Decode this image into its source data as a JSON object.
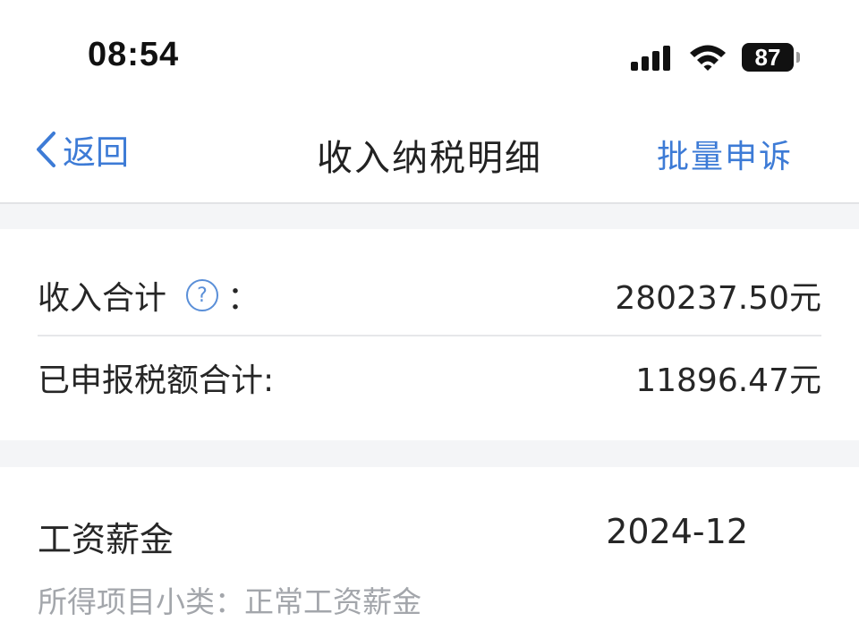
{
  "status_bar": {
    "time": "08:54",
    "battery": "87",
    "icons": [
      "signal-icon",
      "wifi-icon",
      "battery-icon"
    ]
  },
  "nav": {
    "back_label": "返回",
    "title": "收入纳税明细",
    "action_label": "批量申诉"
  },
  "summary": {
    "income_label": "收入合计",
    "income_colon": "：",
    "income_value": "280237.50元",
    "tax_label": "已申报税额合计:",
    "tax_value": "11896.47元"
  },
  "record": {
    "type": "工资薪金",
    "period": "2024-12",
    "subtype": "所得项目小类：正常工资薪金"
  },
  "colors": {
    "accent": "#3d7bd6",
    "background": "#f4f5f7",
    "text_primary": "#262626",
    "text_secondary": "#a3a6ab"
  }
}
